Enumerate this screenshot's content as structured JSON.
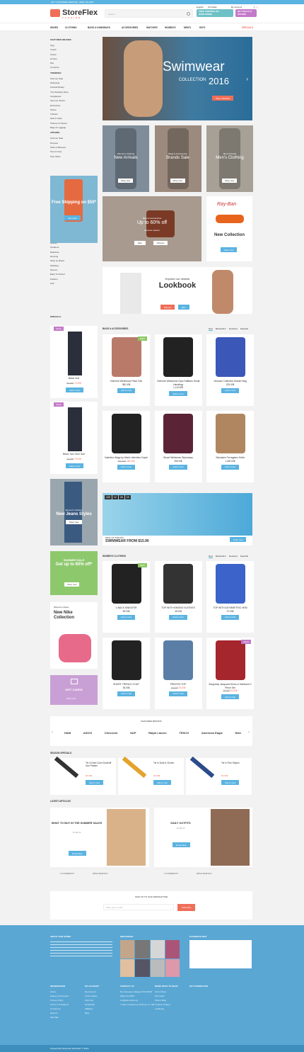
{
  "topbar": {
    "text": "24/7 CUSTOMER SERVICE : (800) 123-4567"
  },
  "header": {
    "logo": "StoreFlex",
    "logo_sub": "FASHION",
    "search_placeholder": "Search",
    "language": "English",
    "currency": "US Dollar",
    "account": "My Account",
    "cart": "0",
    "promo1": "FREE SHIPPING ON WORLDWIDE",
    "promo2": "BUY DEALS & OFFERS"
  },
  "nav": [
    "SHOES",
    "CLOTHING",
    "BAGS & HANDBAGS",
    "ACCESSORIES",
    "WATCHES",
    "WOMEN'S",
    "MEN'S",
    "KID'S",
    "SPECIALS"
  ],
  "sidebar": {
    "featured_title": "FEATURED BRANDS",
    "featured": [
      "Ugg",
      "Coach",
      "Guess",
      "Armani",
      "Fila",
      "Converse"
    ],
    "trending_title": "TRENDING",
    "trending": [
      "Summer Sale",
      "Workwear",
      "Festival Ready",
      "The Wedding Shop",
      "Sunglasses",
      "Summer Shorts",
      "Exclusives",
      "Shoes",
      "Trainers",
      "Hats & Caps",
      "Scarves & Gloves",
      "Bags & Luggage"
    ],
    "apparel_title": "APPAREL",
    "apparel": [
      "Summer Sale",
      "Dresses",
      "Shirts & Blouses",
      "Tees & Tops",
      "Polo Shirts"
    ],
    "shipping_banner": {
      "title": "Free Shipping on $50*",
      "btn": "Use code"
    },
    "shops_title": "SPECIALTY SHOPS",
    "shops": [
      "The Style Room",
      "Athletic",
      "Outdoors",
      "Rideshop",
      "Running",
      "Shop by Brand",
      "Wedding",
      "Women",
      "Back To School",
      "Fashion",
      "Golf"
    ],
    "specials_title": "SPECIALS"
  },
  "hero": {
    "title": "Swimwear",
    "subtitle": "COLLECTION",
    "year": "2016",
    "btn": "Shop collection"
  },
  "promos": [
    {
      "label": "Women's Clothing",
      "title": "New Arrivals",
      "btn": "Shop now"
    },
    {
      "label": "Bags & Accessories",
      "title": "Brands Sale",
      "btn": "Shop now"
    },
    {
      "label": "Men's Arrivals",
      "title": "Men's Clothing",
      "btn": "Shop now"
    }
  ],
  "bags_promo": {
    "label": "Bags & Accessories",
    "title": "Up to 60% off",
    "sub": "Summer season",
    "btn1": "Men",
    "btn2": "Women"
  },
  "rayban": {
    "brand": "Ray-Ban",
    "title": "New Collection",
    "btn": "Shop now"
  },
  "lookbook": {
    "pre": "Explore our newest",
    "title": "Lookbook",
    "btn1": "Women",
    "btn2": "Men"
  },
  "specials": [
    {
      "name": "Basic Suit",
      "old": "80.00$",
      "price": "70.00$"
    },
    {
      "name": "Basic Two-Tone Suit",
      "old": "75.00$",
      "price": "70.00$"
    }
  ],
  "bags_section": {
    "title": "BAGS & ACCESSORIES",
    "tabs": [
      "New",
      "Bestsellers",
      "Featured",
      "Specials"
    ],
    "items": [
      {
        "name": "Vivienne Westwood Plaid Tote",
        "price": "380.00$",
        "badge": "NEW"
      },
      {
        "name": "Vivienne Westwood Opio Saffiano Small Handbag",
        "price": "1,110.00$",
        "badge": ""
      },
      {
        "name": "Versace Collection Bowler Bag",
        "price": "225.00$",
        "badge": ""
      },
      {
        "name": "Valentino Bags by Mario Valentino Dopie",
        "old": "400.00$",
        "price": "280.00$",
        "badge": ""
      },
      {
        "name": "Stuart Weitzman Diplomacy",
        "price": "495.00$",
        "badge": ""
      },
      {
        "name": "Salvatore Ferragamo Sofia",
        "price": "1,500.00$",
        "badge": ""
      }
    ],
    "btn": "Add to Cart"
  },
  "jeans_banner": {
    "label": "Women's Clothing",
    "title": "New Jeans Styles",
    "btn": "Shop now"
  },
  "deal": {
    "label": "DEAL OF THE DAY",
    "title": "SWIMWEAR FROM $15.90",
    "btn": "Shop now",
    "timer": [
      "433",
      "12",
      "26",
      "15"
    ]
  },
  "summer_sale": {
    "title": "SUMMER SALE",
    "sub": "Get up to 60% off*",
    "btn": "Shop now"
  },
  "nike": {
    "label": "Women's shoes",
    "title": "New Nike Collection"
  },
  "gift": {
    "title": "GIFT CARDS",
    "btn": "Shop now"
  },
  "women_section": {
    "title": "WOMEN'S CLOTHING",
    "tabs": [
      "New",
      "Bestsellers",
      "Featured",
      "Specials"
    ],
    "items": [
      {
        "name": "V-BACK SWEATER",
        "price": "55.00$",
        "badge": "NEW"
      },
      {
        "name": "TOP WITH KIMONO SLEEVES",
        "price": "45.00$",
        "badge": ""
      },
      {
        "name": "TOP WITH ASYMMETRIC HEM",
        "price": "37.00$",
        "badge": ""
      },
      {
        "name": "SHORT TRENCH COAT",
        "price": "35.00$",
        "badge": ""
      },
      {
        "name": "PRINTED TOP",
        "old": "45.00$",
        "price": "35.00$",
        "badge": ""
      },
      {
        "name": "Burgundy Jacquard Dress & Hairband 2 Piece Set",
        "old": "75.00$",
        "price": "60.00$",
        "badge": "SALE"
      }
    ],
    "btn": "Add to Cart"
  },
  "brands": {
    "title": "FEATURED BRANDS",
    "items": [
      "H&M",
      "ASICS",
      "Chevrolet",
      "GAP",
      "Ralph Lauren",
      "TESCO",
      "American Eagle",
      "Nike"
    ]
  },
  "season": {
    "title": "SEASON SPECIALS",
    "items": [
      {
        "name": "Tie in Dark Color Dovbluff Icon Pattern",
        "old": "90.00$",
        "price": "90.00$"
      },
      {
        "name": "Tie In Dots & Circles",
        "old": "90.00$",
        "price": "90.00$"
      },
      {
        "name": "Tie In Five Stripes",
        "old": "90.00$",
        "price": "90.00$"
      }
    ],
    "btn": "Add to Cart"
  },
  "articles": {
    "title": "LATEST ARTICLES",
    "items": [
      {
        "title": "WHAT TO BUY IN THE SUMMER SALES",
        "date": "19.08.16",
        "btn": "Read More",
        "comments": "3 COMMENTS",
        "author": "EDNA BARTON"
      },
      {
        "title": "DAILY OUTFITS",
        "date": "19.08.16",
        "btn": "Read More",
        "comments": "3 COMMENTS",
        "author": "EDNA BARTON"
      }
    ]
  },
  "newsletter": {
    "title": "SIGN UP TO OUR NEWSLETTER",
    "placeholder": "Enter your e-mail",
    "btn": "Subscribe"
  },
  "footer": {
    "about_title": "ABOUT OUR STORE",
    "instagram": "INSTAGRAM",
    "facebook": "FACEBOOK BOX",
    "info_title": "INFORMATION",
    "info": [
      "About",
      "Delivery Information",
      "Privacy Policy",
      "Terms & Conditions",
      "Contact Us",
      "Returns",
      "Site Map"
    ],
    "account_title": "MY ACCOUNT",
    "account": [
      "My Account",
      "Order History",
      "Wish List",
      "Newsletter",
      "Affiliates",
      "Blog"
    ],
    "contact_title": "CONTACT US",
    "contact": [
      "My Company Glasgow D04 89GR",
      "(800) 123-4567",
      "info@demolink.org",
      "7 Days a week from 9:00 am to 7:00 pm"
    ],
    "more_title": "MORE WAYS TO SHOP",
    "more": [
      "Find a Store",
      "Gift Cards",
      "Shop's Blog",
      "Product Catalog",
      "Lookbook"
    ],
    "connected_title": "GET CONNECTED",
    "copyright": "Powered By OpenCart StoreFlex © 2016"
  }
}
